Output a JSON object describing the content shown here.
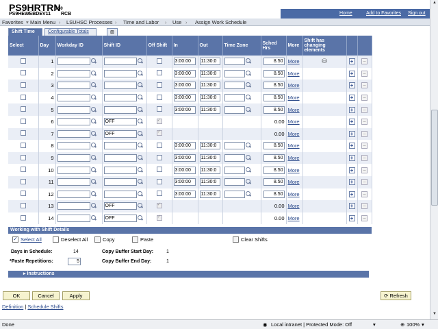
{
  "header": {
    "logo": "PS9HRTRN",
    "version": "8.50",
    "db": "PS9HEWEBDEV11",
    "user": "RCB",
    "links": [
      "Home",
      "Add to Favorites",
      "Sign out"
    ]
  },
  "nav": {
    "items": [
      "Favorites",
      "Main Menu",
      "LSUHSC Processes",
      "Time and Labor",
      "Use",
      "Assign Work Schedule"
    ]
  },
  "tabs": {
    "active": "Shift Time",
    "inactive": "Configurable Totals"
  },
  "grid": {
    "headers": {
      "select": "Select",
      "day": "Day",
      "workday": "Workday ID",
      "shift": "Shift ID",
      "off": "Off Shift",
      "in": "In",
      "out": "Out",
      "tz": "Time Zone",
      "sched": "Sched Hrs",
      "more": "More",
      "changing": "Shift has changing elements"
    },
    "rows": [
      {
        "day": "1",
        "shift": "",
        "off": false,
        "in": "3:00:00",
        "out": "11:30:0",
        "hrs": "8.50",
        "more": "More"
      },
      {
        "day": "2",
        "shift": "",
        "off": false,
        "in": "3:00:00",
        "out": "11:30:0",
        "hrs": "8.50",
        "more": "More"
      },
      {
        "day": "3",
        "shift": "",
        "off": false,
        "in": "3:00:00",
        "out": "11:30:0",
        "hrs": "8.50",
        "more": "More"
      },
      {
        "day": "4",
        "shift": "",
        "off": false,
        "in": "3:00:00",
        "out": "11:30:0",
        "hrs": "8.50",
        "more": "More"
      },
      {
        "day": "5",
        "shift": "",
        "off": false,
        "in": "3:00:00",
        "out": "11:30:0",
        "hrs": "8.50",
        "more": "More"
      },
      {
        "day": "6",
        "shift": "OFF",
        "off": true,
        "in": "",
        "out": "",
        "hrs": "0.00",
        "more": "More"
      },
      {
        "day": "7",
        "shift": "OFF",
        "off": true,
        "in": "",
        "out": "",
        "hrs": "0.00",
        "more": "More"
      },
      {
        "day": "8",
        "shift": "",
        "off": false,
        "in": "3:00:00",
        "out": "11:30:0",
        "hrs": "8.50",
        "more": "More"
      },
      {
        "day": "9",
        "shift": "",
        "off": false,
        "in": "3:00:00",
        "out": "11:30:0",
        "hrs": "8.50",
        "more": "More"
      },
      {
        "day": "10",
        "shift": "",
        "off": false,
        "in": "3:00:00",
        "out": "11:30:0",
        "hrs": "8.50",
        "more": "More"
      },
      {
        "day": "11",
        "shift": "",
        "off": false,
        "in": "3:00:00",
        "out": "11:30:0",
        "hrs": "8.50",
        "more": "More"
      },
      {
        "day": "12",
        "shift": "",
        "off": false,
        "in": "3:00:00",
        "out": "11:30:0",
        "hrs": "8.50",
        "more": "More"
      },
      {
        "day": "13",
        "shift": "OFF",
        "off": true,
        "in": "",
        "out": "",
        "hrs": "0.00",
        "more": "More"
      },
      {
        "day": "14",
        "shift": "OFF",
        "off": true,
        "in": "",
        "out": "",
        "hrs": "0.00",
        "more": "More"
      }
    ]
  },
  "details": {
    "title": "Working with Shift Details",
    "select_all": "Select All",
    "deselect_all": "Deselect All",
    "copy": "Copy",
    "paste": "Paste",
    "clear": "Clear Shifts",
    "days_label": "Days in Schedule:",
    "days_value": "14",
    "paste_label": "*Paste Repetitions:",
    "paste_value": "5",
    "buf_start_label": "Copy Buffer Start Day:",
    "buf_start_value": "1",
    "buf_end_label": "Copy Buffer End Day:",
    "buf_end_value": "1"
  },
  "instructions": "Instructions",
  "buttons": {
    "ok": "OK",
    "cancel": "Cancel",
    "apply": "Apply",
    "refresh": "Refresh"
  },
  "bottom_links": {
    "definition": "Definition",
    "sep": "|",
    "schedule": "Schedule Shifts"
  },
  "status": {
    "left": "Done",
    "zone": "Local intranet | Protected Mode: Off",
    "zoom": "100%"
  }
}
